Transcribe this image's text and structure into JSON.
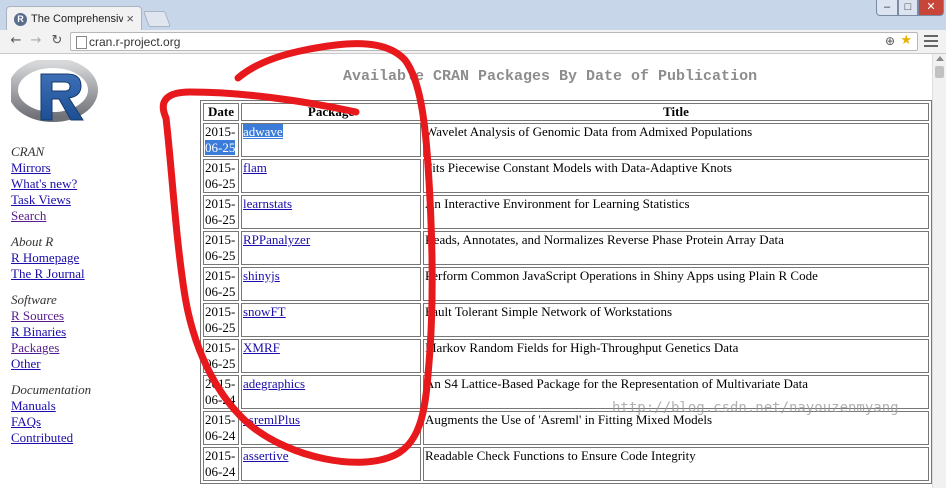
{
  "browser": {
    "tab_title": "The Comprehensive R Arc",
    "tab_close": "×",
    "url": "cran.r-project.org",
    "favicon_letter": "R"
  },
  "sidebar": {
    "groups": [
      {
        "heading": "CRAN",
        "links": [
          "Mirrors",
          "What's new?",
          "Task Views",
          "Search"
        ]
      },
      {
        "heading": "About R",
        "links": [
          "R Homepage",
          "The R Journal"
        ]
      },
      {
        "heading": "Software",
        "links": [
          "R Sources",
          "R Binaries",
          "Packages",
          "Other"
        ]
      },
      {
        "heading": "Documentation",
        "links": [
          "Manuals",
          "FAQs",
          "Contributed"
        ]
      }
    ]
  },
  "main": {
    "title": "Available CRAN Packages By Date of Publication",
    "columns": [
      "Date",
      "Package",
      "Title"
    ],
    "rows": [
      {
        "date": "2015-06-25",
        "package": "adwave",
        "title": "Wavelet Analysis of Genomic Data from Admixed Populations"
      },
      {
        "date": "2015-06-25",
        "package": "flam",
        "title": "Fits Piecewise Constant Models with Data-Adaptive Knots"
      },
      {
        "date": "2015-06-25",
        "package": "learnstats",
        "title": "An Interactive Environment for Learning Statistics"
      },
      {
        "date": "2015-06-25",
        "package": "RPPanalyzer",
        "title": "Reads, Annotates, and Normalizes Reverse Phase Protein Array Data"
      },
      {
        "date": "2015-06-25",
        "package": "shinyjs",
        "title": "Perform Common JavaScript Operations in Shiny Apps using Plain R Code"
      },
      {
        "date": "2015-06-25",
        "package": "snowFT",
        "title": "Fault Tolerant Simple Network of Workstations"
      },
      {
        "date": "2015-06-25",
        "package": "XMRF",
        "title": "Markov Random Fields for High-Throughput Genetics Data"
      },
      {
        "date": "2015-06-24",
        "package": "adegraphics",
        "title": "An S4 Lattice-Based Package for the Representation of Multivariate Data"
      },
      {
        "date": "2015-06-24",
        "package": "asremlPlus",
        "title": "Augments the Use of 'Asreml' in Fitting Mixed Models"
      },
      {
        "date": "2015-06-24",
        "package": "assertive",
        "title": "Readable Check Functions to Ensure Code Integrity"
      }
    ]
  },
  "watermark": "http://blog.csdn.net/nayouzenmyang",
  "colors": {
    "link": "#1a0dab",
    "visited": "#551a8b",
    "scribble": "#e8191c",
    "selection": "#3b7bd9"
  }
}
